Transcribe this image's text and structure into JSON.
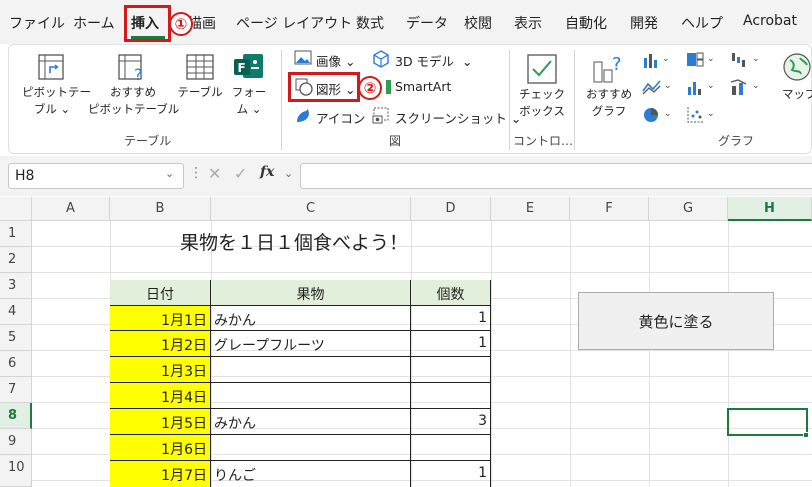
{
  "menu": {
    "items": [
      "ファイル",
      "ホーム",
      "挿入",
      "描画",
      "ページ レイアウト",
      "数式",
      "データ",
      "校閲",
      "表示",
      "自動化",
      "開発",
      "ヘルプ",
      "Acrobat"
    ],
    "active": "挿入"
  },
  "callouts": [
    "①",
    "②"
  ],
  "ribbon": {
    "table_group": {
      "label": "テーブル",
      "pivot_table": [
        "ピボットテー",
        "ブル"
      ],
      "recommended_pivot": [
        "おすすめ",
        "ピボットテーブル"
      ],
      "table": "テーブル",
      "forms": [
        "フォー",
        "ム"
      ]
    },
    "illustrations_group": {
      "label": "図",
      "image": "画像",
      "model_3d": "3D モデル",
      "shapes": "図形",
      "smartart": "SmartArt",
      "icons": "アイコン",
      "screenshot": "スクリーンショット"
    },
    "controls_group": {
      "label": "コントロ…",
      "checkbox": [
        "チェック",
        "ボックス"
      ]
    },
    "charts_group": {
      "label": "グラフ",
      "recommended_charts": [
        "おすすめ",
        "グラフ"
      ],
      "maps": "マップ"
    }
  },
  "formula_bar": {
    "name_box": "H8",
    "fx": "fx",
    "value": ""
  },
  "grid": {
    "columns": [
      "A",
      "B",
      "C",
      "D",
      "E",
      "F",
      "G",
      "H"
    ],
    "selected_column": "H",
    "rows": [
      "1",
      "2",
      "3",
      "4",
      "5",
      "6",
      "7",
      "8",
      "9",
      "10"
    ],
    "selected_row": "8",
    "title": "果物を１日１個食べよう！",
    "table": {
      "headers": [
        "日付",
        "果物",
        "個数"
      ],
      "rows": [
        {
          "date": "1月1日",
          "fruit": "みかん",
          "count": "1"
        },
        {
          "date": "1月2日",
          "fruit": "グレープフルーツ",
          "count": "1"
        },
        {
          "date": "1月3日",
          "fruit": "",
          "count": ""
        },
        {
          "date": "1月4日",
          "fruit": "",
          "count": ""
        },
        {
          "date": "1月5日",
          "fruit": "みかん",
          "count": "3"
        },
        {
          "date": "1月6日",
          "fruit": "",
          "count": ""
        },
        {
          "date": "1月7日",
          "fruit": "りんご",
          "count": "1"
        }
      ]
    },
    "button_label": "黄色に塗る"
  },
  "colors": {
    "accent_green": "#1e7a3c",
    "highlight_red": "#d21a1a",
    "date_fill": "#ffff00",
    "header_fill": "#e2efda"
  }
}
